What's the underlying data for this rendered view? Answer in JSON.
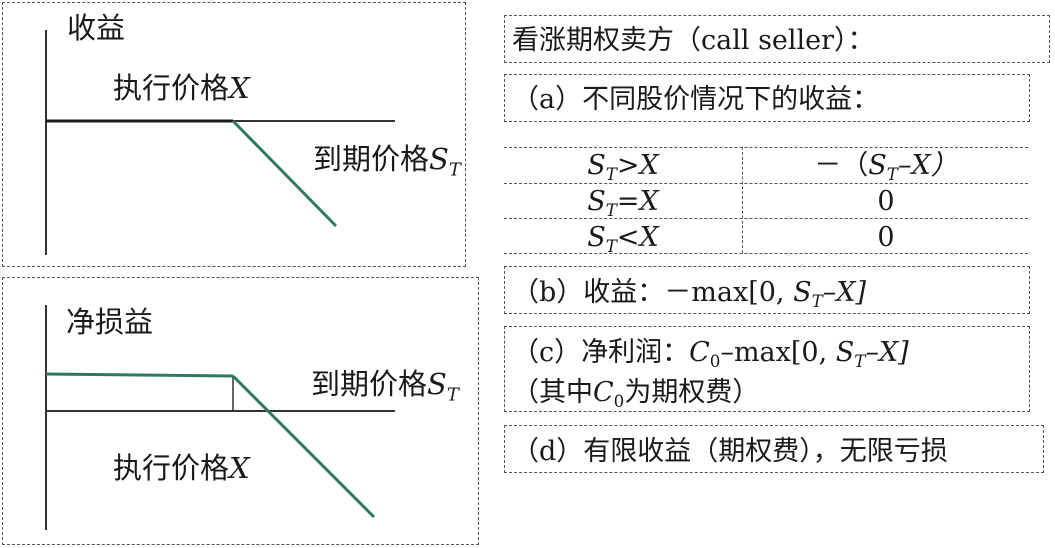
{
  "colors": {
    "payoff_line": "#2f7a5c",
    "axis": "#333333",
    "border": "#555555"
  },
  "top_panel": {
    "title": "收益",
    "strike_label_cn": "执行价格",
    "strike_label_var": "X",
    "expiry_label_cn": "到期价格",
    "expiry_label_var": "S",
    "expiry_label_sub": "T"
  },
  "bottom_panel": {
    "title": "净损益",
    "strike_label_cn": "执行价格",
    "strike_label_var": "X",
    "expiry_label_cn": "到期价格",
    "expiry_label_var": "S",
    "expiry_label_sub": "T"
  },
  "right": {
    "heading": "看涨期权卖方（call seller）：",
    "a_title": "（a）不同股价情况下的收益：",
    "table": [
      {
        "cond_var": "S",
        "cond_sub": "T",
        "cond_op": ">X",
        "value": "－（S_T–X）"
      },
      {
        "cond_var": "S",
        "cond_sub": "T",
        "cond_op": "=X",
        "value": "0"
      },
      {
        "cond_var": "S",
        "cond_sub": "T",
        "cond_op": "<X",
        "value": "0"
      }
    ],
    "row1_value": {
      "pre": "－（",
      "var": "S",
      "sub": "T",
      "post": "–X）"
    },
    "b": {
      "pre": "（b）收益：－max[0, ",
      "var": "S",
      "sub": "T",
      "post": "–X]"
    },
    "c_line1": {
      "pre": "（c）净利润：",
      "c": "C",
      "c_sub": "0",
      "mid": "–max[0, ",
      "var": "S",
      "sub": "T",
      "post": "–X]"
    },
    "c_line2": {
      "pre": "（其中",
      "c": "C",
      "c_sub": "0",
      "post": "为期权费）"
    },
    "d": "（d）有限收益（期权费），无限亏损"
  }
}
